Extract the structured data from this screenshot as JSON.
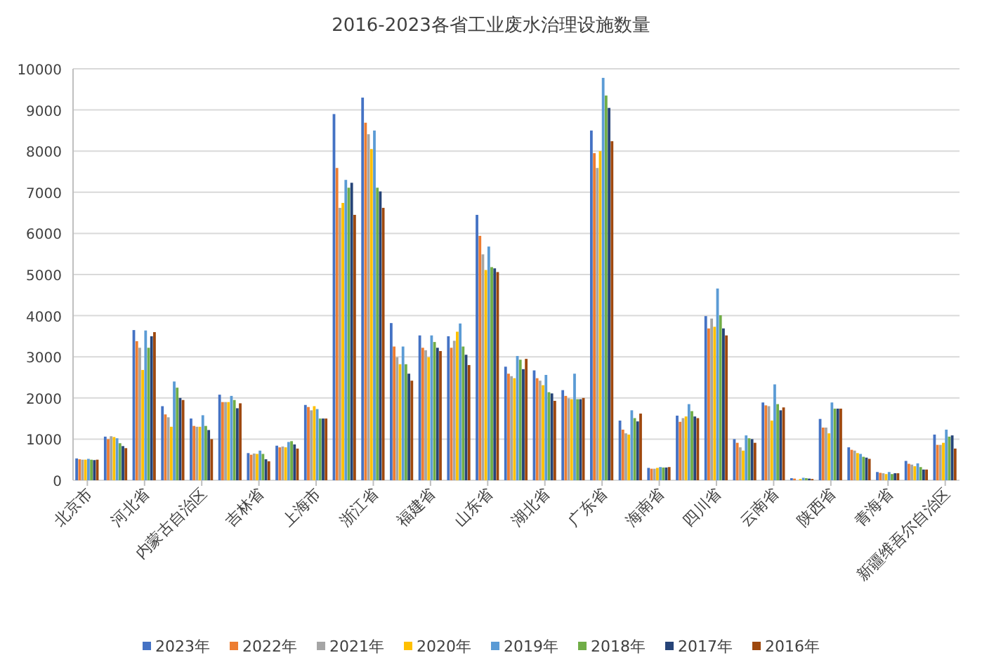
{
  "chart_data": {
    "type": "bar",
    "title": "2016-2023各省工业废水治理设施数量",
    "categories": [
      "北京市",
      null,
      "河北省",
      null,
      "内蒙古自治区",
      null,
      "吉林省",
      null,
      "上海市",
      null,
      "浙江省",
      null,
      "福建省",
      null,
      "山东省",
      null,
      "湖北省",
      null,
      "广东省",
      null,
      "海南省",
      null,
      "四川省",
      null,
      "云南省",
      null,
      "陕西省",
      null,
      "青海省",
      null,
      "新疆维吾尔自治区"
    ],
    "grid": true,
    "legend": "bottom",
    "ylim": [
      0,
      10000
    ],
    "yticks": [
      0,
      1000,
      2000,
      3000,
      4000,
      5000,
      6000,
      7000,
      8000,
      9000,
      10000
    ],
    "series": [
      {
        "name": "2023年",
        "color": "#4472c4",
        "values": [
          530,
          1060,
          3650,
          1800,
          1500,
          2080,
          660,
          840,
          1830,
          8900,
          9300,
          3820,
          3520,
          3500,
          6450,
          2760,
          2670,
          2190,
          8500,
          1450,
          300,
          1570,
          3990,
          1000,
          1890,
          50,
          1490,
          800,
          200,
          470,
          1110
        ]
      },
      {
        "name": "2022年",
        "color": "#ed7d31",
        "values": [
          510,
          1000,
          3380,
          1600,
          1320,
          1900,
          620,
          800,
          1780,
          7590,
          8690,
          3250,
          3220,
          3220,
          5940,
          2590,
          2480,
          2050,
          7950,
          1230,
          280,
          1420,
          3690,
          910,
          1820,
          40,
          1280,
          740,
          180,
          400,
          860
        ]
      },
      {
        "name": "2021年",
        "color": "#a5a5a5",
        "values": [
          500,
          1070,
          3220,
          1530,
          1300,
          1900,
          650,
          820,
          1700,
          6620,
          8410,
          2990,
          3160,
          3390,
          5490,
          2530,
          2420,
          1990,
          7590,
          1140,
          280,
          1510,
          3930,
          800,
          1800,
          null,
          1280,
          720,
          170,
          380,
          860
        ]
      },
      {
        "name": "2020年",
        "color": "#ffc000",
        "values": [
          500,
          1050,
          2680,
          1300,
          1300,
          1900,
          640,
          800,
          1800,
          6740,
          8050,
          2820,
          2990,
          3610,
          5110,
          2480,
          2310,
          1970,
          8000,
          1110,
          300,
          1550,
          3730,
          720,
          1450,
          30,
          1140,
          660,
          150,
          340,
          910
        ]
      },
      {
        "name": "2019年",
        "color": "#5b9bd5",
        "values": [
          520,
          1020,
          3640,
          2400,
          1580,
          2050,
          720,
          930,
          1730,
          7300,
          8500,
          3250,
          3520,
          3810,
          5680,
          3020,
          2560,
          2590,
          9780,
          1700,
          320,
          1850,
          4660,
          1090,
          2330,
          60,
          1890,
          640,
          200,
          410,
          1230
        ]
      },
      {
        "name": "2018年",
        "color": "#70ad47",
        "values": [
          500,
          900,
          3220,
          2250,
          1320,
          1950,
          640,
          950,
          1500,
          7110,
          7110,
          2820,
          3360,
          3250,
          5180,
          2930,
          2140,
          1970,
          9350,
          1510,
          310,
          1680,
          4010,
          1020,
          1850,
          50,
          1740,
          570,
          150,
          320,
          1060
        ]
      },
      {
        "name": "2017年",
        "color": "#264478",
        "values": [
          490,
          830,
          3500,
          2000,
          1220,
          1750,
          510,
          870,
          1500,
          7230,
          7020,
          2590,
          3220,
          3050,
          5150,
          2700,
          2110,
          1970,
          9050,
          1430,
          310,
          1550,
          3690,
          1000,
          1700,
          40,
          1740,
          550,
          170,
          260,
          1090
        ]
      },
      {
        "name": "2016年",
        "color": "#9e480e",
        "values": [
          500,
          780,
          3600,
          1950,
          1000,
          1870,
          460,
          770,
          1500,
          6450,
          6620,
          2420,
          3140,
          2800,
          5060,
          2950,
          1930,
          2000,
          8240,
          1620,
          320,
          1510,
          3520,
          910,
          1770,
          30,
          1740,
          520,
          170,
          260,
          770
        ]
      }
    ]
  }
}
